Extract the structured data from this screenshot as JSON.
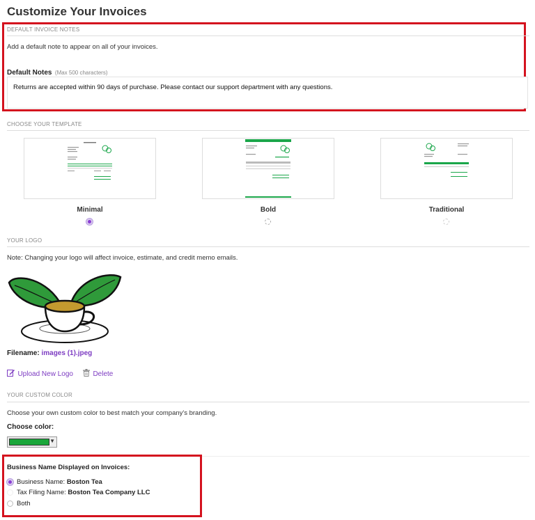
{
  "page": {
    "title": "Customize Your Invoices"
  },
  "invoice_notes": {
    "section_title": "DEFAULT INVOICE NOTES",
    "description": "Add a default note to appear on all of your invoices.",
    "field_label": "Default Notes",
    "field_hint": "(Max 500 characters)",
    "value": "Returns are accepted within 90 days of purchase. Please contact our support department with any questions."
  },
  "templates": {
    "section_title": "CHOOSE YOUR TEMPLATE",
    "accent_color": "#1aa64a",
    "items": [
      {
        "name": "Minimal",
        "selected": true
      },
      {
        "name": "Bold",
        "selected": false
      },
      {
        "name": "Traditional",
        "selected": false
      }
    ]
  },
  "logo": {
    "section_title": "YOUR LOGO",
    "note": "Note: Changing your logo will affect invoice, estimate, and credit memo emails.",
    "filename_label": "Filename:",
    "filename": "images (1).jpeg",
    "upload_label": "Upload New Logo",
    "delete_label": "Delete"
  },
  "custom_color": {
    "section_title": "YOUR CUSTOM COLOR",
    "description": "Choose your own custom color to best match your company's branding.",
    "choose_label": "Choose color:",
    "selected_color": "#1aa63a"
  },
  "business_name": {
    "title": "Business Name Displayed on Invoices:",
    "options": [
      {
        "prefix": "Business Name:",
        "value": "Boston Tea",
        "selected": true
      },
      {
        "prefix": "Tax Filing Name:",
        "value": "Boston Tea Company LLC",
        "selected": false
      },
      {
        "prefix": "Both",
        "value": "",
        "selected": false
      }
    ]
  },
  "colors": {
    "accent": "#7d3cc2",
    "highlight_border": "#d4121e"
  }
}
